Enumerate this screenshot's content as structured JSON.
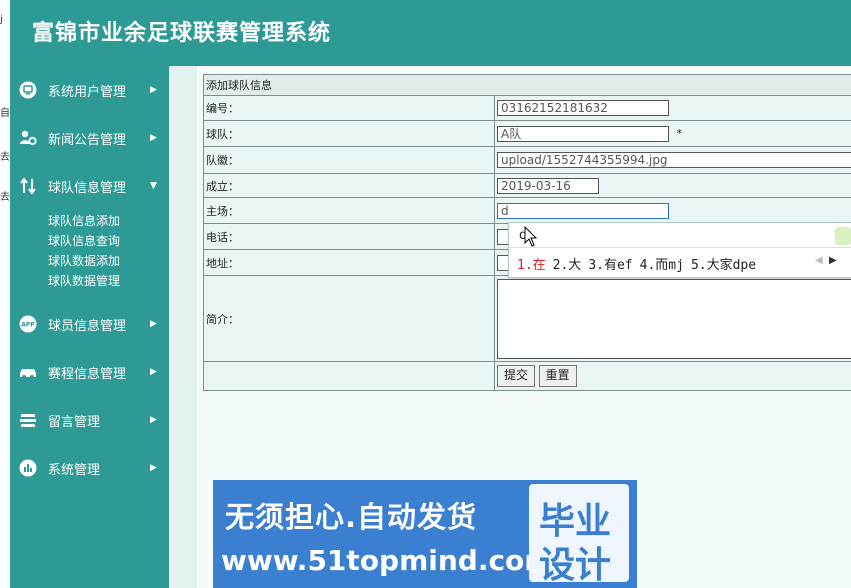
{
  "header": {
    "title": "富锦市业余足球联赛管理系统"
  },
  "edge": {
    "glyphs": [
      "j",
      "自",
      "去",
      "去"
    ]
  },
  "sidebar": {
    "items": [
      {
        "label": "系统用户管理",
        "icon": "monitor-icon"
      },
      {
        "label": "新闻公告管理",
        "icon": "users-gear-icon"
      },
      {
        "label": "球队信息管理",
        "icon": "swap-arrows-icon",
        "expanded": true
      },
      {
        "label": "球员信息管理",
        "icon": "app-icon"
      },
      {
        "label": "赛程信息管理",
        "icon": "car-icon"
      },
      {
        "label": "留言管理",
        "icon": "stack-icon"
      },
      {
        "label": "系统管理",
        "icon": "bar-chart-icon"
      }
    ],
    "subitems": [
      "球队信息添加",
      "球队信息查询",
      "球队数据添加",
      "球队数据管理"
    ]
  },
  "form": {
    "title": "添加球队信息",
    "fields": [
      {
        "label": "编号：",
        "value": "03162152181632"
      },
      {
        "label": "球队：",
        "value": "A队",
        "required": "*"
      },
      {
        "label": "队徽：",
        "value": "upload/1552744355994.jpg"
      },
      {
        "label": "成立：",
        "value": "2019-03-16"
      },
      {
        "label": "主场：",
        "value": "d"
      },
      {
        "label": "电话：",
        "value": ""
      },
      {
        "label": "地址：",
        "value": ""
      },
      {
        "label": "简介：",
        "value": ""
      }
    ],
    "submit": "提交",
    "reset": "重置"
  },
  "ime": {
    "composition": "d",
    "candidates": [
      "1.在",
      "2.大",
      "3.有ef",
      "4.而mj",
      "5.大家dpe"
    ],
    "selected_color": "#e02020"
  },
  "watermark": {
    "line1": "无须担心.自动发货",
    "line2": "www.51topmind.com",
    "box1": "毕业",
    "box2": "设计"
  },
  "colors": {
    "primary": "#2e9a96",
    "content_bg": "#f4fbfb",
    "watermark_bg": "#3a7fd0"
  }
}
